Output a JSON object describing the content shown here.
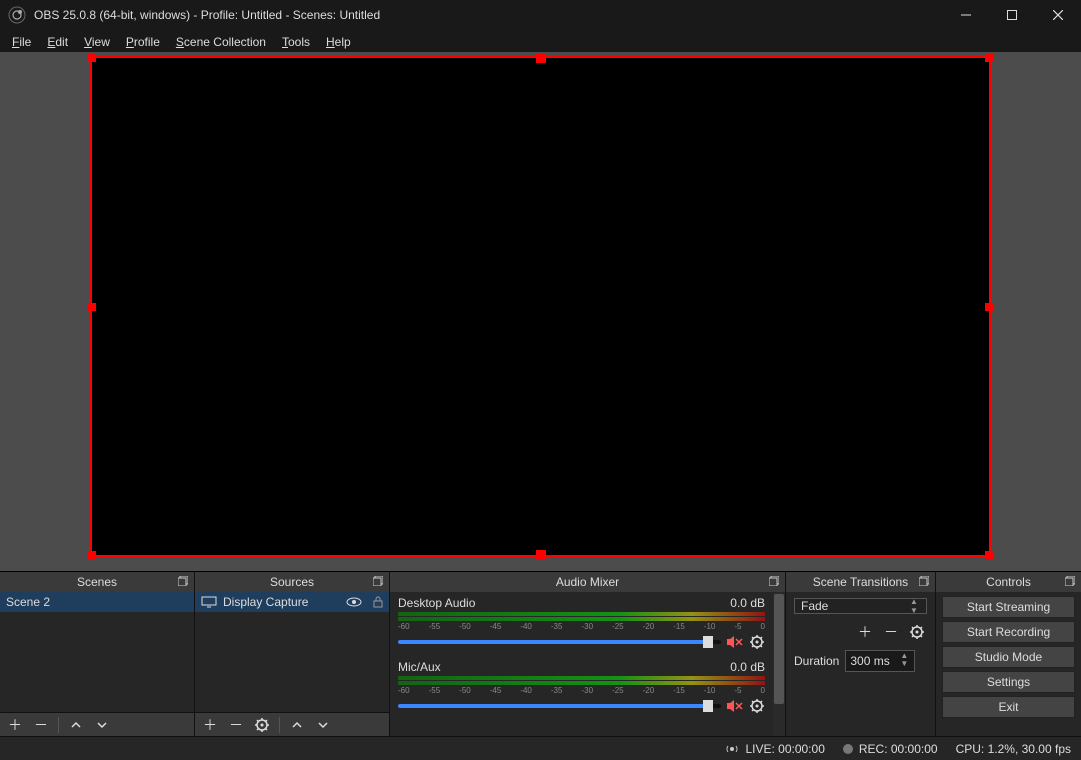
{
  "window": {
    "title": "OBS 25.0.8 (64-bit, windows) - Profile: Untitled - Scenes: Untitled"
  },
  "menu": {
    "file": "File",
    "edit": "Edit",
    "view": "View",
    "profile": "Profile",
    "scene_collection": "Scene Collection",
    "tools": "Tools",
    "help": "Help"
  },
  "panels": {
    "scenes": {
      "title": "Scenes",
      "items": [
        "Scene 2"
      ]
    },
    "sources": {
      "title": "Sources",
      "items": [
        {
          "label": "Display Capture"
        }
      ]
    },
    "mixer": {
      "title": "Audio Mixer",
      "tracks": [
        {
          "name": "Desktop Audio",
          "level": "0.0 dB"
        },
        {
          "name": "Mic/Aux",
          "level": "0.0 dB"
        }
      ],
      "ticks": [
        "-60",
        "-55",
        "-50",
        "-45",
        "-40",
        "-35",
        "-30",
        "-25",
        "-20",
        "-15",
        "-10",
        "-5",
        "0"
      ]
    },
    "transitions": {
      "title": "Scene Transitions",
      "selected": "Fade",
      "duration_label": "Duration",
      "duration_value": "300 ms"
    },
    "controls": {
      "title": "Controls",
      "buttons": {
        "start_streaming": "Start Streaming",
        "start_recording": "Start Recording",
        "studio_mode": "Studio Mode",
        "settings": "Settings",
        "exit": "Exit"
      }
    }
  },
  "status": {
    "live": "LIVE: 00:00:00",
    "rec": "REC: 00:00:00",
    "cpu": "CPU: 1.2%, 30.00 fps"
  }
}
